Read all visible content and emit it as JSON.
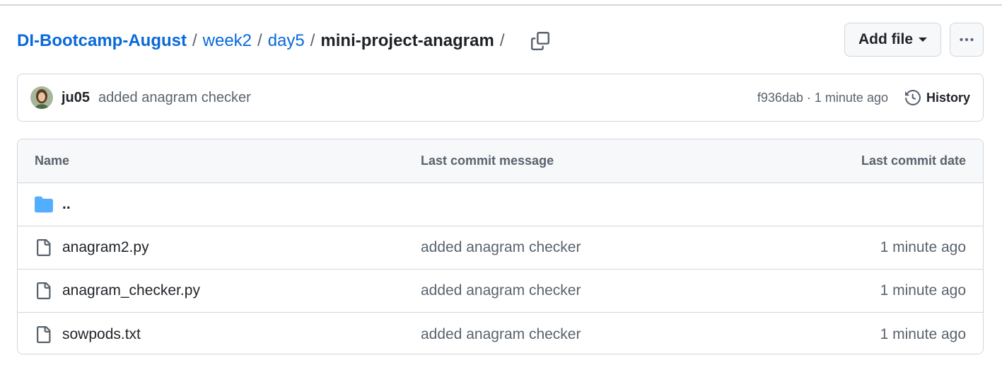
{
  "breadcrumb": {
    "root": "DI-Bootcamp-August",
    "parts": [
      "week2",
      "day5"
    ],
    "current": "mini-project-anagram",
    "separator": "/"
  },
  "actions": {
    "add_file_label": "Add file",
    "more_icon": "kebab-horizontal-icon",
    "copy_icon": "copy-icon"
  },
  "commit": {
    "author": "ju05",
    "message": "added anagram checker",
    "meta": "f936dab · 1 minute ago",
    "history_label": "History"
  },
  "table": {
    "headers": {
      "name": "Name",
      "message": "Last commit message",
      "date": "Last commit date"
    },
    "parent_label": "..",
    "rows": [
      {
        "name": "anagram2.py",
        "message": "added anagram checker",
        "date": "1 minute ago",
        "icon": "file-icon"
      },
      {
        "name": "anagram_checker.py",
        "message": "added anagram checker",
        "date": "1 minute ago",
        "icon": "file-icon"
      },
      {
        "name": "sowpods.txt",
        "message": "added anagram checker",
        "date": "1 minute ago",
        "icon": "file-icon"
      }
    ]
  },
  "colors": {
    "link": "#0969da",
    "folder": "#54aeff",
    "muted": "#59636e",
    "border": "#d0d7de"
  }
}
